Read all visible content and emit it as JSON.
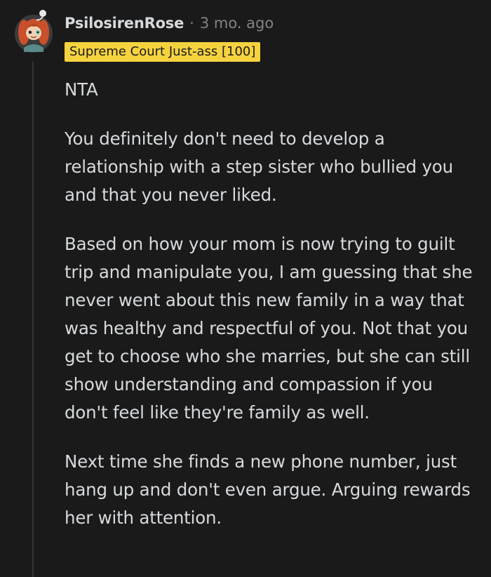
{
  "comment": {
    "author": "PsilosirenRose",
    "separator": "·",
    "timestamp": "3 mo. ago",
    "flair": "Supreme Court Just-ass [100]",
    "avatar_icon": "snoo-avatar-icon",
    "paragraphs": [
      "NTA",
      "You definitely don't need to develop a relationship with a step sister who bullied you and that you never liked.",
      "Based on how your mom is now trying to guilt trip and manipulate you, I am guessing that she never went about this new family in a way that was healthy and respectful of you. Not that you get to choose who she marries, but she can still show understanding and compassion if you don't feel like they're family as well.",
      "Next time she finds a new phone number, just hang up and don't even argue. Arguing rewards her with attention."
    ]
  },
  "colors": {
    "background": "#1a1a1b",
    "text": "#d7dadc",
    "meta": "#818384",
    "flair_bg": "#f5d33f",
    "flair_text": "#1a1a1b",
    "thread_line": "#343536"
  }
}
